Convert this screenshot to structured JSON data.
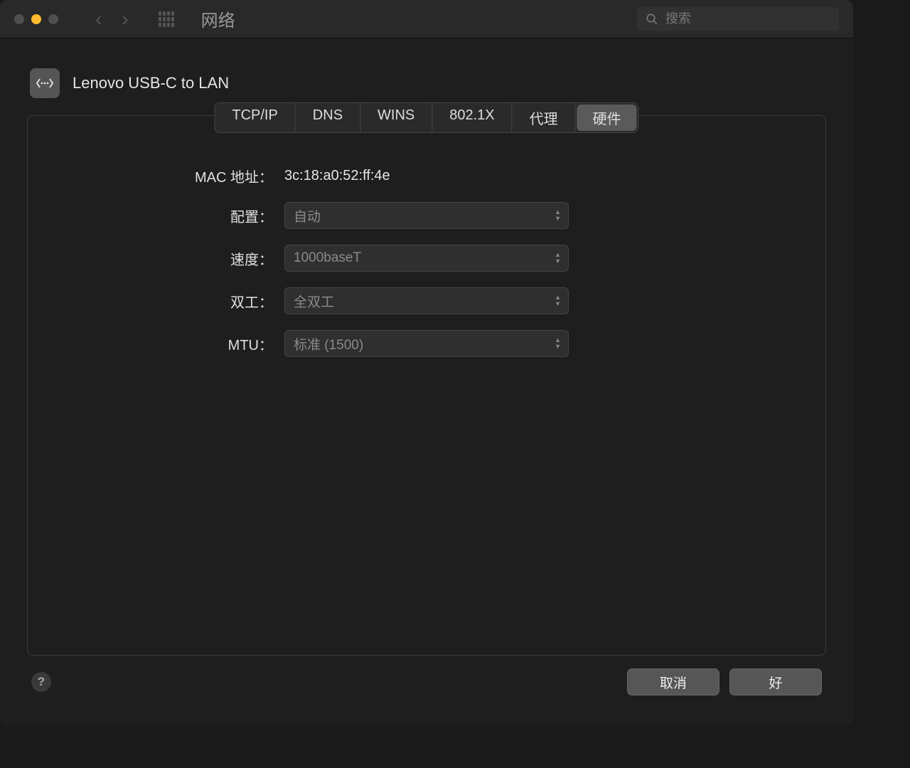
{
  "window": {
    "title": "网络",
    "search_placeholder": "搜索"
  },
  "adapter": {
    "name": "Lenovo USB-C to LAN"
  },
  "tabs": [
    {
      "label": "TCP/IP",
      "active": false
    },
    {
      "label": "DNS",
      "active": false
    },
    {
      "label": "WINS",
      "active": false
    },
    {
      "label": "802.1X",
      "active": false
    },
    {
      "label": "代理",
      "active": false
    },
    {
      "label": "硬件",
      "active": true
    }
  ],
  "form": {
    "mac_label": "MAC 地址：",
    "mac_value": "3c:18:a0:52:ff:4e",
    "configure_label": "配置：",
    "configure_value": "自动",
    "speed_label": "速度：",
    "speed_value": "1000baseT",
    "duplex_label": "双工：",
    "duplex_value": "全双工",
    "mtu_label": "MTU：",
    "mtu_value": "标准 (1500)"
  },
  "buttons": {
    "cancel": "取消",
    "ok": "好",
    "help": "?"
  }
}
